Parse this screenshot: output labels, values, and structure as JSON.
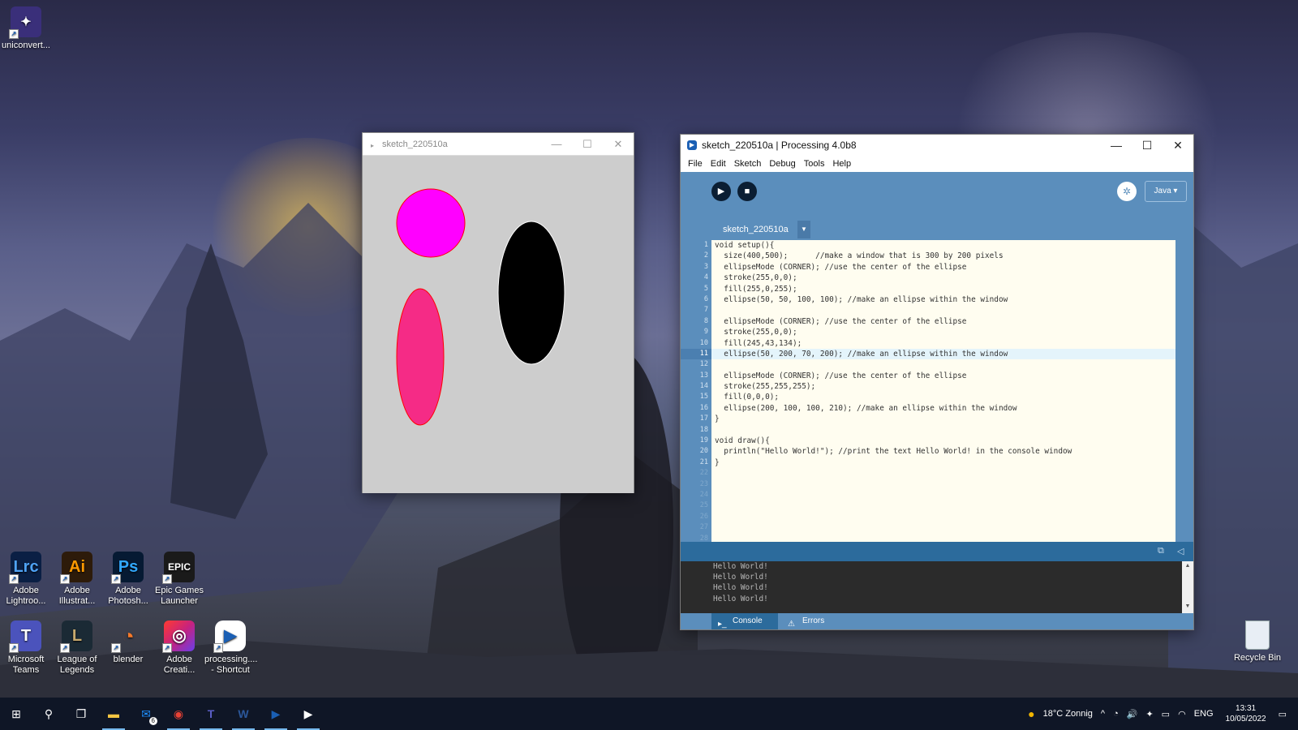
{
  "desktop": {
    "top_icon": {
      "label": "uniconvert..."
    },
    "icons": [
      {
        "tile": "Lrc",
        "label": "Adobe Lightroo...",
        "bg": "#0a1f44",
        "fg": "#4fa3f7"
      },
      {
        "tile": "Ai",
        "label": "Adobe Illustrat...",
        "bg": "#2d1b0a",
        "fg": "#ff9a00"
      },
      {
        "tile": "Ps",
        "label": "Adobe Photosh...",
        "bg": "#061a33",
        "fg": "#31a8ff"
      },
      {
        "tile": "EPIC",
        "label": "Epic Games Launcher",
        "bg": "#1a1a1a",
        "fg": "#ffffff"
      },
      {
        "tile": "T",
        "label": "Microsoft Teams",
        "bg": "#4b53bc",
        "fg": "#ffffff"
      },
      {
        "tile": "L",
        "label": "League of Legends",
        "bg": "#1b2a35",
        "fg": "#c8aa6e"
      },
      {
        "tile": "◔",
        "label": "blender",
        "bg": "transparent",
        "fg": "#f5792a"
      },
      {
        "tile": "◎",
        "label": "Adobe Creati...",
        "bg": "#e53a3a",
        "fg": "#ffffff"
      },
      {
        "tile": "▶",
        "label": "processing.... - Shortcut",
        "bg": "#ffffff",
        "fg": "#1a5fb4"
      }
    ],
    "recycle_bin": {
      "label": "Recycle Bin"
    }
  },
  "sketch_window": {
    "title": "sketch_220510a",
    "controls": {
      "minimize": "—",
      "maximize": "☐",
      "close": "✕"
    },
    "canvas_bg": "#cdcdcd",
    "shapes": [
      {
        "kind": "circle",
        "fill": "#ff00ff",
        "stroke": "#ff0000"
      },
      {
        "kind": "ellipse",
        "fill": "#f52b86",
        "stroke": "#ff0000"
      },
      {
        "kind": "ellipse",
        "fill": "#000000",
        "stroke": "#ffffff"
      }
    ]
  },
  "ide": {
    "title": "sketch_220510a | Processing 4.0b8",
    "controls": {
      "minimize": "—",
      "maximize": "☐",
      "close": "✕"
    },
    "menu": [
      "File",
      "Edit",
      "Sketch",
      "Debug",
      "Tools",
      "Help"
    ],
    "run_icon": "▶",
    "stop_icon": "■",
    "debug_icon": "✲",
    "mode_label": "Java ▾",
    "tab_label": "sketch_220510a",
    "tab_menu_icon": "▼",
    "highlight_line": 11,
    "code_lines": [
      "void setup(){",
      "  size(400,500);      //make a window that is 300 by 200 pixels",
      "  ellipseMode (CORNER); //use the center of the ellipse",
      "  stroke(255,0,0);",
      "  fill(255,0,255);",
      "  ellipse(50, 50, 100, 100); //make an ellipse within the window",
      "",
      "  ellipseMode (CORNER); //use the center of the ellipse",
      "  stroke(255,0,0);",
      "  fill(245,43,134);",
      "  ellipse(50, 200, 70, 200); //make an ellipse within the window",
      "",
      "  ellipseMode (CORNER); //use the center of the ellipse",
      "  stroke(255,255,255);",
      "  fill(0,0,0);",
      "  ellipse(200, 100, 100, 210); //make an ellipse within the window",
      "}",
      "",
      "void draw(){",
      "  println(\"Hello World!\"); //print the text Hello World! in the console window",
      "}",
      "",
      "",
      "",
      "",
      "",
      "",
      ""
    ],
    "line_numbers": [
      "1",
      "2",
      "3",
      "4",
      "5",
      "6",
      "7",
      "8",
      "9",
      "10",
      "11",
      "12",
      "13",
      "14",
      "15",
      "16",
      "17",
      "18",
      "19",
      "20",
      "21",
      "22",
      "23",
      "24",
      "25",
      "26",
      "27",
      "28"
    ],
    "console_lines": [
      "Hello World!",
      "Hello World!",
      "Hello World!",
      "Hello World!"
    ],
    "console_tabs": [
      {
        "label": "Console",
        "icon": "▸_"
      },
      {
        "label": "Errors",
        "icon": "⚠"
      }
    ],
    "console_icons": {
      "copy": "⧉",
      "collapse": "◁"
    },
    "scroll_up": "▲",
    "scroll_down": "▼"
  },
  "taskbar": {
    "start_icon": "⊞",
    "search_icon": "⚲",
    "taskview_icon": "❐",
    "apps": [
      {
        "name": "file-explorer",
        "glyph": "▬",
        "color": "#f4c542"
      },
      {
        "name": "mail",
        "glyph": "✉",
        "color": "#1e90ff",
        "badge": "6"
      },
      {
        "name": "chrome",
        "glyph": "◉",
        "color": "#e94235"
      },
      {
        "name": "teams",
        "glyph": "T",
        "color": "#5b5fc7"
      },
      {
        "name": "word",
        "glyph": "W",
        "color": "#2b579a"
      },
      {
        "name": "processing",
        "glyph": "▶",
        "color": "#1a5fb4"
      },
      {
        "name": "processing-sketch",
        "glyph": "▶",
        "color": "#ffffff"
      }
    ],
    "weather": "18°C  Zonnig",
    "weather_icon": "●",
    "tray_icons": [
      "^",
      "◔",
      "🔊",
      "✦",
      "▭",
      "◠"
    ],
    "lang": "ENG",
    "time": "13:31",
    "date": "10/05/2022",
    "notification_icon": "▭"
  }
}
